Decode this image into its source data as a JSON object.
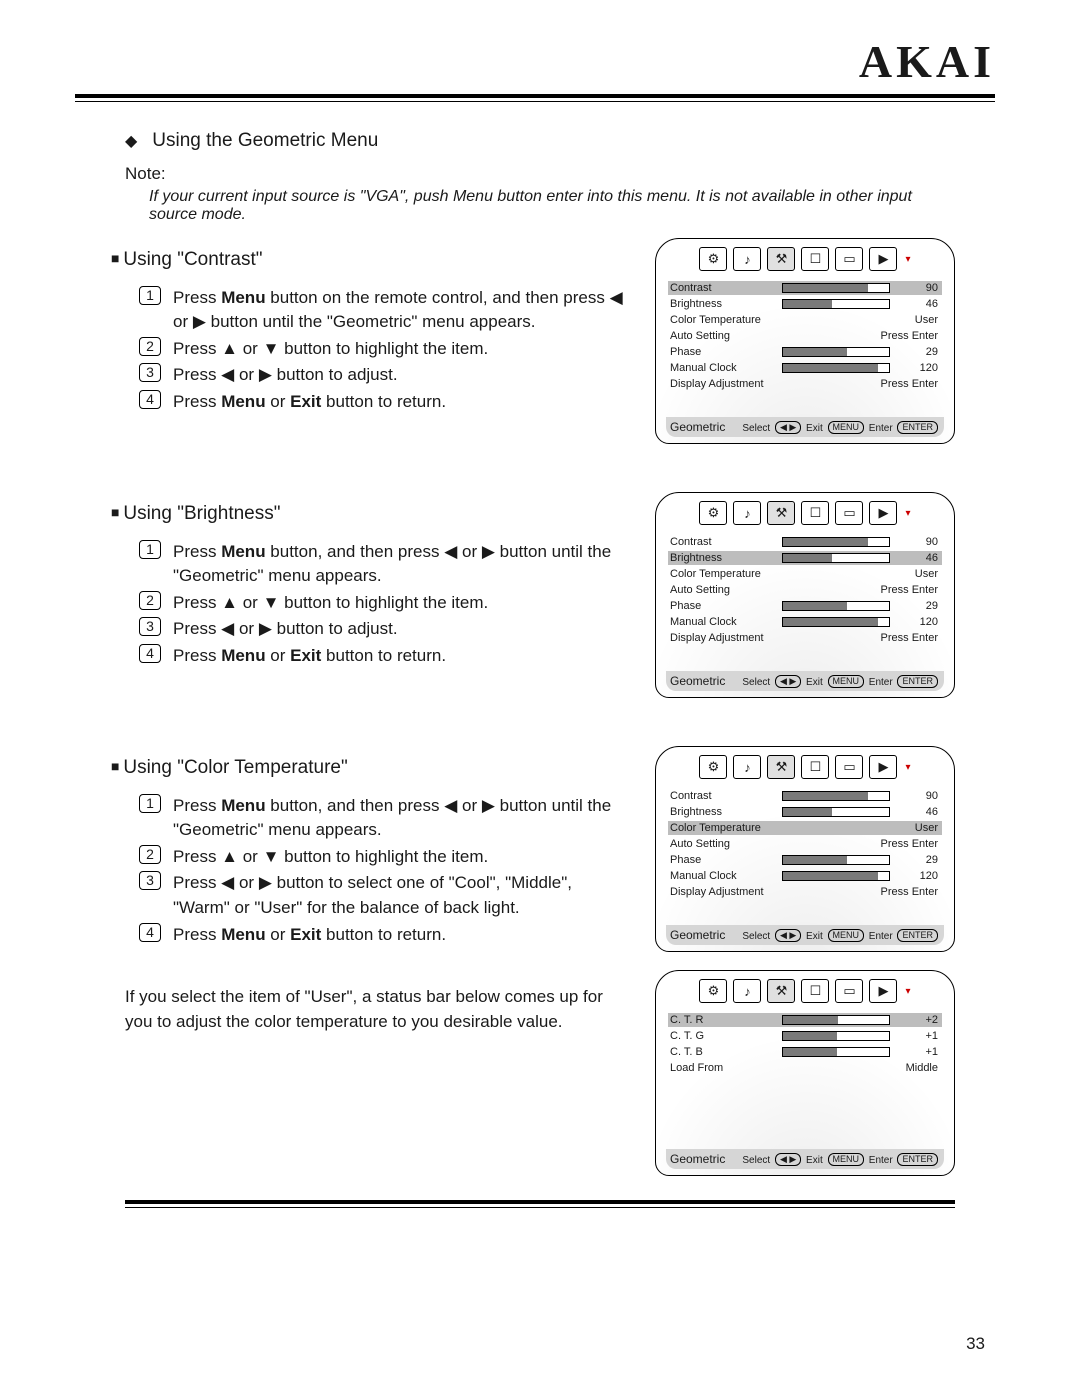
{
  "brand": "AKAI",
  "page_number": "33",
  "sections": {
    "main_heading": "Using the Geometric Menu",
    "note_label": "Note:",
    "note_body": "If your current input source is \"VGA\", push Menu button enter into this menu. It is not available in other input source mode.",
    "contrast": {
      "heading": "Using \"Contrast\"",
      "step1a": "Press ",
      "step1b": "Menu",
      "step1c": " button on the remote control, and then press ◀ or ▶ button until the \"Geometric\" menu appears.",
      "step2": "Press ▲ or ▼ button to highlight the item.",
      "step3": "Press ◀ or ▶ button to adjust.",
      "step4a": "Press ",
      "step4b": "Menu",
      "step4c": " or ",
      "step4d": "Exit",
      "step4e": " button to return."
    },
    "brightness": {
      "heading": "Using \"Brightness\"",
      "step1a": "Press ",
      "step1b": "Menu",
      "step1c": " button, and then press ◀ or ▶ button until the \"Geometric\" menu appears.",
      "step2": "Press ▲ or ▼ button to highlight the  item.",
      "step3": "Press ◀ or ▶ button to adjust.",
      "step4a": "Press ",
      "step4b": "Menu",
      "step4c": " or ",
      "step4d": "Exit",
      "step4e": " button to return."
    },
    "color_temp": {
      "heading": "Using \"Color Temperature\"",
      "step1a": "Press ",
      "step1b": "Menu",
      "step1c": " button, and then press ◀ or ▶ button until the \"Geometric\" menu appears.",
      "step2": "Press ▲ or ▼ button to highlight the item.",
      "step3": "Press ◀ or ▶ button to select one of \"Cool\", \"Middle\", \"Warm\" or \"User\" for the balance of back light.",
      "step4a": "Press ",
      "step4b": "Menu",
      "step4c": " or ",
      "step4d": "Exit",
      "step4e": " button to return.",
      "user_note": "If you select the item of \"User\", a status bar below comes up for you to adjust the color temperature to you desirable value."
    }
  },
  "osd": {
    "tabs": [
      "⚙",
      "♪",
      "⚒",
      "☐",
      "▭",
      "▶"
    ],
    "active_tab_index": 2,
    "footer_title": "Geometric",
    "footer_select": "Select",
    "arrows_label": "◀ ▶",
    "footer_exit": "Exit",
    "menu_label": "MENU",
    "footer_enter": "Enter",
    "enter_label": "ENTER",
    "rows": {
      "contrast": {
        "label": "Contrast",
        "value": "90",
        "pct": 80
      },
      "brightness": {
        "label": "Brightness",
        "value": "46",
        "pct": 46
      },
      "color_temp": {
        "label": "Color Temperature",
        "text": "User"
      },
      "auto_setting": {
        "label": "Auto Setting",
        "text": "Press Enter"
      },
      "phase": {
        "label": "Phase",
        "value": "29",
        "pct": 60
      },
      "manual_clock": {
        "label": "Manual Clock",
        "value": "120",
        "pct": 90
      },
      "display_adj": {
        "label": "Display Adjustment",
        "text": "Press Enter"
      }
    },
    "user_rows": {
      "ctr": {
        "label": "C. T. R",
        "value": "+2",
        "pct": 52
      },
      "ctg": {
        "label": "C. T. G",
        "value": "+1",
        "pct": 51
      },
      "ctb": {
        "label": "C. T. B",
        "value": "+1",
        "pct": 51
      },
      "load": {
        "label": "Load From",
        "text": "Middle"
      }
    }
  }
}
